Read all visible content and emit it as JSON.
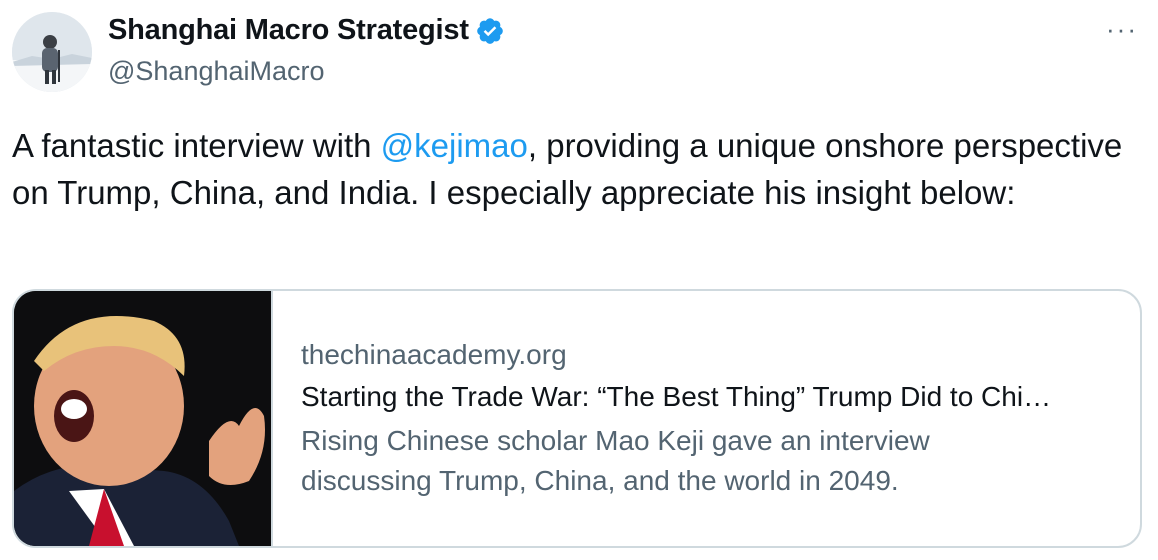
{
  "author": {
    "display_name": "Shanghai Macro Strategist",
    "handle": "@ShanghaiMacro",
    "verified": true
  },
  "more_menu": "···",
  "tweet": {
    "text_before": "A fantastic interview with ",
    "mention": "@kejimao",
    "text_after": ", providing a unique onshore perspective on Trump, China, and India. I especially appreciate his insight below:"
  },
  "link_card": {
    "domain": "thechinaacademy.org",
    "title": "Starting the Trade War: “The Best Thing” Trump Did to Chi…",
    "description": "Rising Chinese scholar Mao Keji gave an interview discussing Trump, China, and the world in 2049."
  },
  "colors": {
    "accent": "#1d9bf0",
    "text_primary": "#0f1419",
    "text_secondary": "#536471",
    "border": "#cfd9de"
  }
}
